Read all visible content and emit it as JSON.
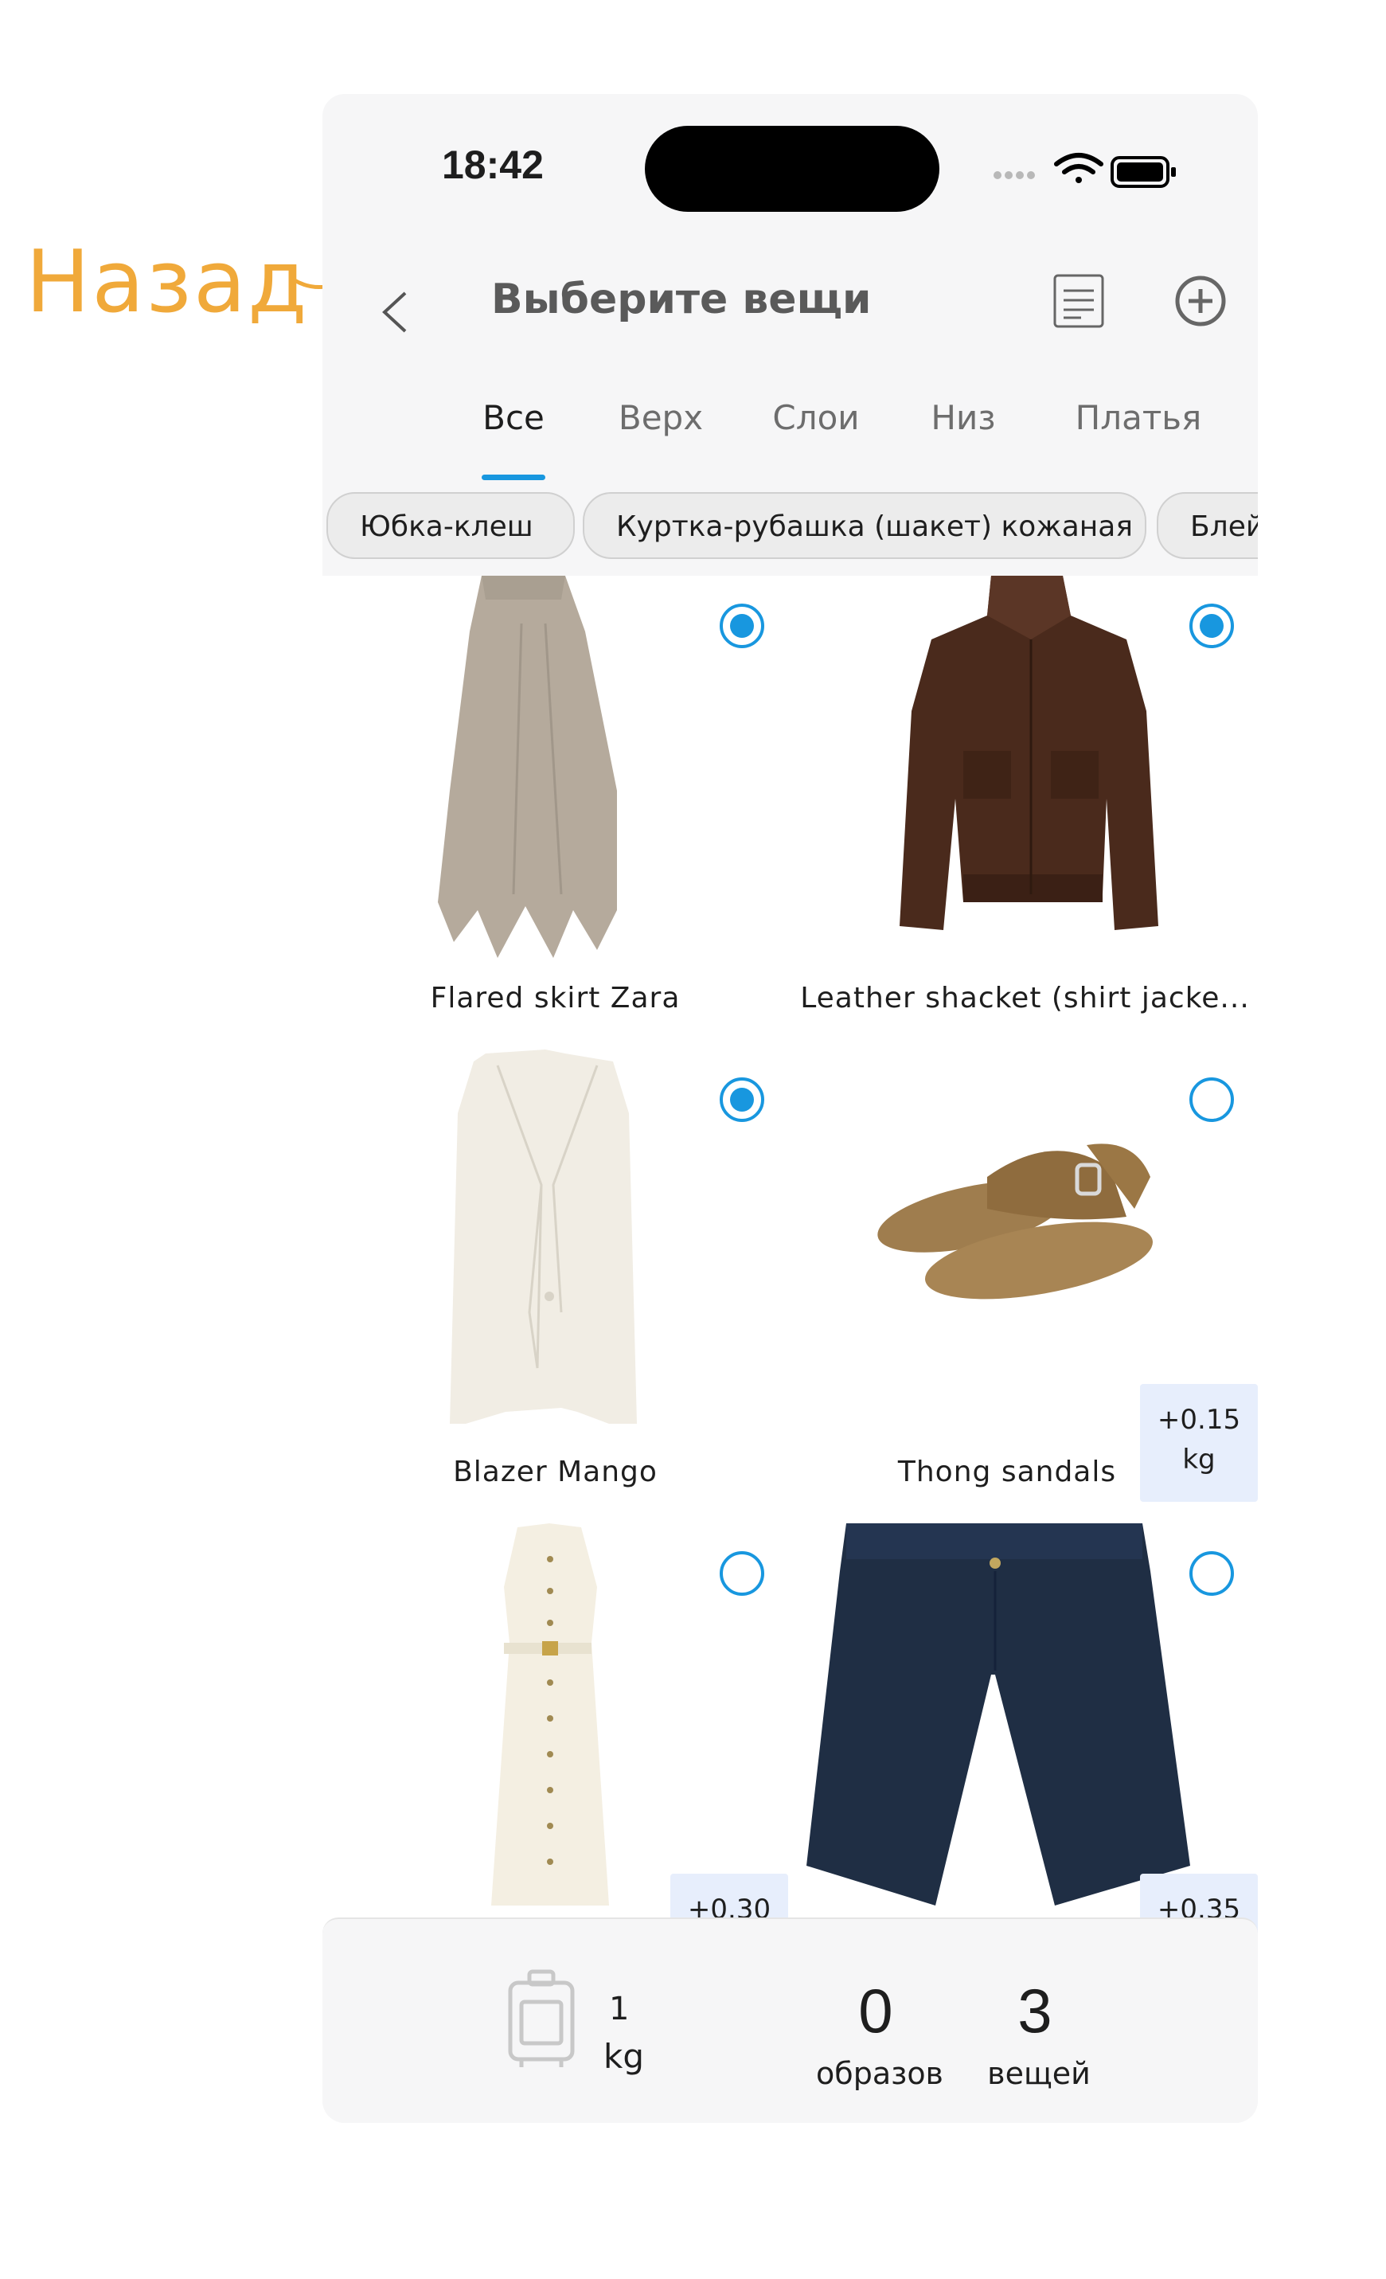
{
  "annotation": {
    "label": "Назад"
  },
  "status_bar": {
    "time": "18:42"
  },
  "header": {
    "title": "Выберите вещи"
  },
  "tabs": [
    {
      "label": "Все",
      "active": true
    },
    {
      "label": "Верх"
    },
    {
      "label": "Слои"
    },
    {
      "label": "Низ"
    },
    {
      "label": "Платья"
    }
  ],
  "chips": [
    {
      "label": "Юбка-клеш"
    },
    {
      "label": "Куртка-рубашка (шакет) кожаная"
    },
    {
      "label": "Блейзер"
    }
  ],
  "items": [
    {
      "name": "Flared skirt Zara",
      "selected": true
    },
    {
      "name": "Leather shacket (shirt jacke...",
      "selected": true
    },
    {
      "name": "Blazer Mango",
      "selected": true
    },
    {
      "name": "Thong sandals",
      "selected": false,
      "weight_value": "+0.15",
      "weight_unit": "kg"
    },
    {
      "name": "",
      "selected": false,
      "weight_value": "+0.30"
    },
    {
      "name": "",
      "selected": false,
      "weight_value": "+0.35"
    }
  ],
  "summary": {
    "weight_value": "1",
    "weight_unit": "kg",
    "outfits_count": "0",
    "outfits_label": "образов",
    "items_count": "3",
    "items_label": "вещей"
  },
  "colors": {
    "accent": "#1897df",
    "annotation": "#f0a93a",
    "badge_bg": "#e7eefc"
  },
  "icons": [
    "back-icon",
    "list-icon",
    "add-circle-icon",
    "luggage-icon",
    "wifi-icon",
    "battery-icon",
    "signal-icon"
  ]
}
